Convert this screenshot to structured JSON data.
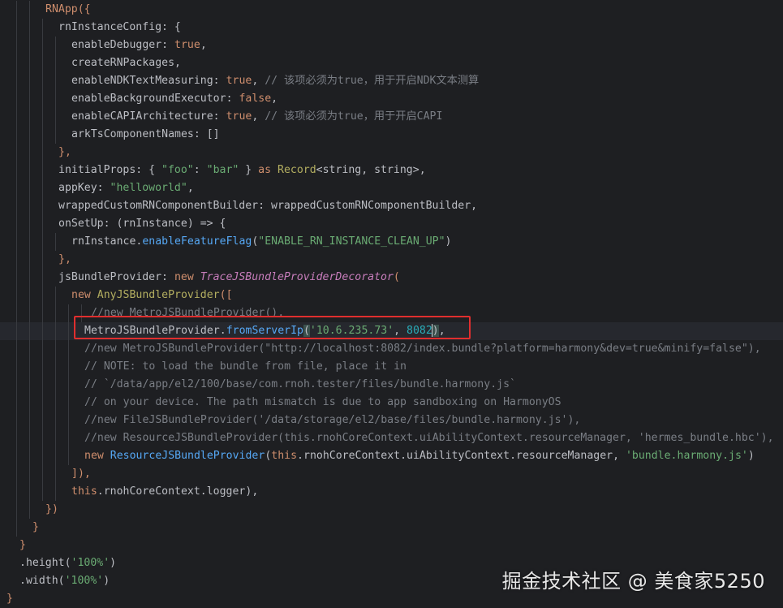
{
  "editor": {
    "background": "#1e1f22",
    "lines": [
      [
        [
          "RNApp({",
          "kw"
        ]
      ],
      [
        [
          "rnInstanceConfig",
          "def"
        ],
        [
          ": {",
          "def"
        ]
      ],
      [
        [
          "enableDebugger",
          "def"
        ],
        [
          ": ",
          "def"
        ],
        [
          "true",
          "kw"
        ],
        [
          ",",
          "def"
        ]
      ],
      [
        [
          "createRNPackages",
          "def"
        ],
        [
          ",",
          "def"
        ]
      ],
      [
        [
          "enableNDKTextMeasuring",
          "def"
        ],
        [
          ": ",
          "def"
        ],
        [
          "true",
          "kw"
        ],
        [
          ", ",
          "def"
        ],
        [
          "// 该项必须为true，用于开启NDK文本测算",
          "cmt"
        ]
      ],
      [
        [
          "enableBackgroundExecutor",
          "def"
        ],
        [
          ": ",
          "def"
        ],
        [
          "false",
          "kw"
        ],
        [
          ",",
          "def"
        ]
      ],
      [
        [
          "enableCAPIArchitecture",
          "def"
        ],
        [
          ": ",
          "def"
        ],
        [
          "true",
          "kw"
        ],
        [
          ", ",
          "def"
        ],
        [
          "// 该项必须为true，用于开启CAPI",
          "cmt"
        ]
      ],
      [
        [
          "arkTsComponentNames",
          "def"
        ],
        [
          ": []",
          "def"
        ]
      ],
      [
        [
          "},",
          "kw"
        ]
      ],
      [
        [
          "initialProps",
          "def"
        ],
        [
          ": { ",
          "def"
        ],
        [
          "\"foo\"",
          "str"
        ],
        [
          ": ",
          "def"
        ],
        [
          "\"bar\"",
          "str"
        ],
        [
          " } ",
          "def"
        ],
        [
          "as ",
          "kw"
        ],
        [
          "Record",
          "ann"
        ],
        [
          "<string, string>",
          "def"
        ],
        [
          ",",
          "def"
        ]
      ],
      [
        [
          "appKey",
          "def"
        ],
        [
          ": ",
          "def"
        ],
        [
          "\"helloworld\"",
          "str"
        ],
        [
          ",",
          "def"
        ]
      ],
      [
        [
          "wrappedCustomRNComponentBuilder",
          "def"
        ],
        [
          ": wrappedCustomRNComponentBuilder,",
          "def"
        ]
      ],
      [
        [
          "onSetUp",
          "def"
        ],
        [
          ": (",
          "def"
        ],
        [
          "rnInstance",
          "def"
        ],
        [
          ") => {",
          "def"
        ]
      ],
      [
        [
          "rnInstance",
          "def"
        ],
        [
          ".",
          "def"
        ],
        [
          "enableFeatureFlag",
          "fn"
        ],
        [
          "(",
          "def"
        ],
        [
          "\"ENABLE_RN_INSTANCE_CLEAN_UP\"",
          "str"
        ],
        [
          ")",
          "def"
        ]
      ],
      [
        [
          "},",
          "kw"
        ]
      ],
      [
        [
          "jsBundleProvider",
          "def"
        ],
        [
          ": ",
          "def"
        ],
        [
          "new ",
          "kw"
        ],
        [
          "TraceJSBundleProviderDecorator",
          "hl"
        ],
        [
          "(",
          "kw"
        ]
      ],
      [
        [
          "new ",
          "kw"
        ],
        [
          "AnyJSBundleProvider",
          "ann"
        ],
        [
          "([",
          "kw"
        ]
      ],
      [
        [
          "//new MetroJSBundleProvider(),",
          "cmt"
        ]
      ],
      [
        [
          "MetroJSBundleProvider",
          "def"
        ],
        [
          ".",
          "def"
        ],
        [
          "fromServerIp",
          "fn"
        ],
        [
          "(",
          "br"
        ],
        [
          "'10.6.235.73'",
          "str"
        ],
        [
          ", ",
          "def"
        ],
        [
          "8082",
          "num"
        ],
        [
          ")",
          "br"
        ],
        [
          ",",
          "def"
        ]
      ],
      [
        [
          "//new MetroJSBundleProvider(\"http://localhost:8082/index.bundle?platform=harmony&dev=true&minify=false\"),",
          "cmt"
        ]
      ],
      [
        [
          "// NOTE: to load the bundle from file, place it in",
          "cmt"
        ]
      ],
      [
        [
          "// `/data/app/el2/100/base/com.rnoh.tester/files/bundle.harmony.js`",
          "cmt"
        ]
      ],
      [
        [
          "// on your device. The path mismatch is due to app sandboxing on HarmonyOS",
          "cmt"
        ]
      ],
      [
        [
          "//new FileJSBundleProvider('/data/storage/el2/base/files/bundle.harmony.js'),",
          "cmt"
        ]
      ],
      [
        [
          "//new ResourceJSBundleProvider(this.rnohCoreContext.uiAbilityContext.resourceManager, 'hermes_bundle.hbc'),",
          "cmt"
        ]
      ],
      [
        [
          "new ",
          "kw"
        ],
        [
          "ResourceJSBundleProvider",
          "fn"
        ],
        [
          "(",
          "def"
        ],
        [
          "this",
          "kw"
        ],
        [
          ".",
          "def"
        ],
        [
          "rnohCoreContext",
          "def"
        ],
        [
          ".uiAbilityContext.resourceManager, ",
          "def"
        ],
        [
          "'bundle.harmony.js'",
          "str"
        ],
        [
          ")",
          "def"
        ]
      ],
      [
        [
          "]),",
          "kw"
        ]
      ],
      [
        [
          "this",
          "kw"
        ],
        [
          ".rnohCoreContext.logger),",
          "def"
        ]
      ],
      [
        [
          "})",
          "kw"
        ]
      ],
      [
        [
          "}",
          "kw"
        ]
      ],
      [
        [
          "}",
          "kw"
        ]
      ],
      [
        [
          ".height(",
          "def"
        ],
        [
          "'100%'",
          "str"
        ],
        [
          ")",
          "def"
        ]
      ],
      [
        [
          ".width(",
          "def"
        ],
        [
          "'100%'",
          "str"
        ],
        [
          ")",
          "def"
        ]
      ],
      [
        [
          "}",
          "kw"
        ]
      ]
    ]
  },
  "watermark": "掘金技术社区 @ 美食家5250"
}
